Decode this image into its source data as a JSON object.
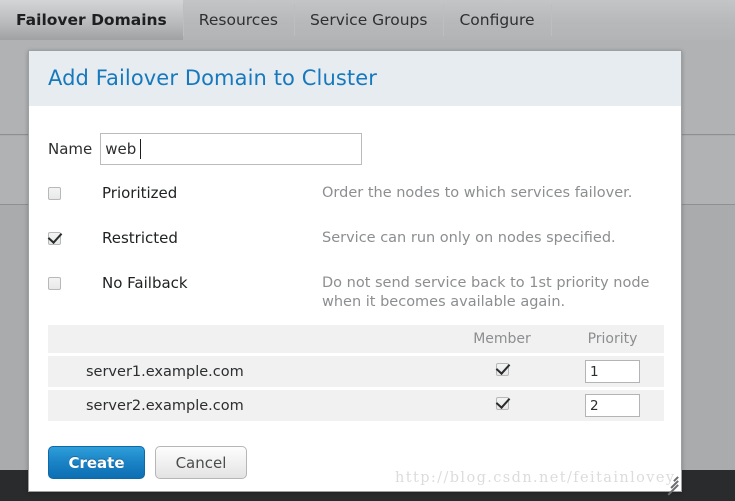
{
  "tabs": [
    {
      "label": "Failover Domains",
      "active": true
    },
    {
      "label": "Resources",
      "active": false
    },
    {
      "label": "Service Groups",
      "active": false
    },
    {
      "label": "Configure",
      "active": false
    }
  ],
  "dialog": {
    "title": "Add Failover Domain to Cluster",
    "name_label": "Name",
    "name_value": "web",
    "name_placeholder": "",
    "options": [
      {
        "label": "Prioritized",
        "description": "Order the nodes to which services failover.",
        "checked": false
      },
      {
        "label": "Restricted",
        "description": "Service can run only on nodes specified.",
        "checked": true
      },
      {
        "label": "No Failback",
        "description": "Do not send service back to 1st priority node when it becomes available again.",
        "checked": false
      }
    ],
    "table": {
      "headers": {
        "node": "",
        "member": "Member",
        "priority": "Priority"
      },
      "rows": [
        {
          "node": "server1.example.com",
          "member_checked": true,
          "priority": "1"
        },
        {
          "node": "server2.example.com",
          "member_checked": true,
          "priority": "2"
        }
      ]
    },
    "create_label": "Create",
    "cancel_label": "Cancel"
  },
  "watermark": "http://blog.csdn.net/feitainlovey",
  "colors": {
    "dialog_title": "#1679bd",
    "dialog_header_bg": "#e7ecf0",
    "primary_button": "#1a83c6",
    "page_bg": "#a9abad",
    "row_bg": "#f1f1f1",
    "muted_text": "#8c8e90"
  }
}
